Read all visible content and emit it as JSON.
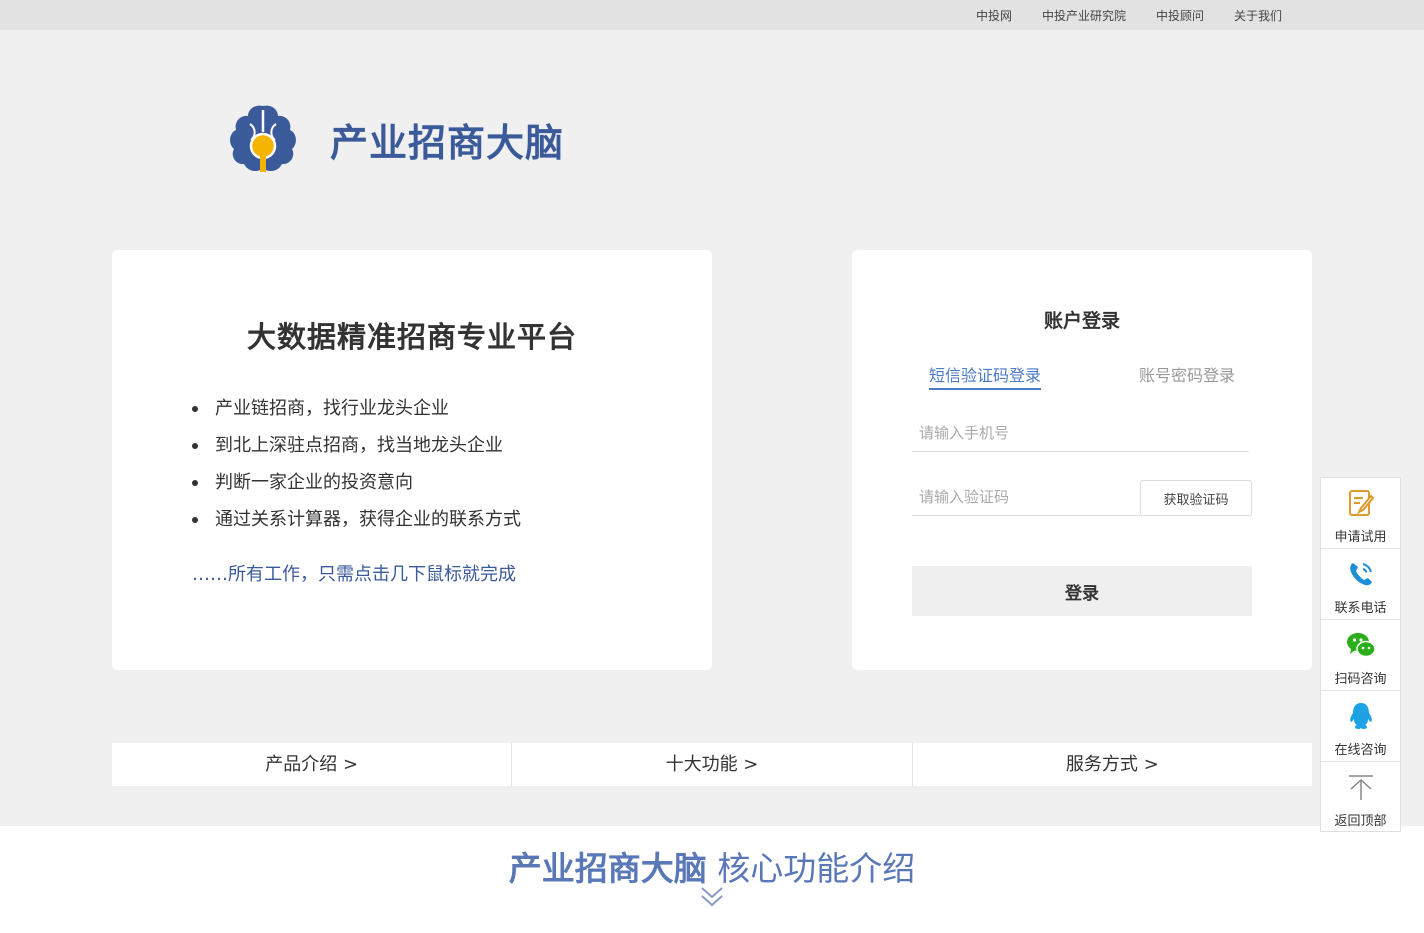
{
  "topnav": {
    "links": [
      "中投网",
      "中投产业研究院",
      "中投顾问",
      "关于我们"
    ]
  },
  "logo": {
    "text": "产业招商大脑",
    "icon": "brain-logo-icon"
  },
  "intro": {
    "title": "大数据精准招商专业平台",
    "bullets": [
      "产业链招商，找行业龙头企业",
      "到北上深驻点招商，找当地龙头企业",
      "判断一家企业的投资意向",
      "通过关系计算器，获得企业的联系方式"
    ],
    "tagline": "……所有工作，只需点击几下鼠标就完成"
  },
  "login": {
    "title": "账户登录",
    "tabs": [
      "短信验证码登录",
      "账号密码登录"
    ],
    "active_tab": "短信验证码登录",
    "phone_placeholder": "请输入手机号",
    "code_placeholder": "请输入验证码",
    "get_code_label": "获取验证码",
    "submit_label": "登录"
  },
  "nav": {
    "items": [
      "产品介绍 >",
      "十大功能 >",
      "服务方式 >"
    ]
  },
  "section": {
    "title_strong": "产业招商大脑",
    "title_rest": " 核心功能介绍"
  },
  "sidebar": {
    "items": [
      {
        "label": "申请试用",
        "icon": "edit-icon"
      },
      {
        "label": "联系电话",
        "icon": "phone-icon"
      },
      {
        "label": "扫码咨询",
        "icon": "wechat-icon"
      },
      {
        "label": "在线咨询",
        "icon": "qq-icon"
      },
      {
        "label": "返回顶部",
        "icon": "back-to-top-icon"
      }
    ]
  },
  "colors": {
    "brand_blue": "#3b5a9a",
    "tab_active": "#4a7ac8",
    "logo_yellow": "#f5b400",
    "wechat_green": "#2aae1a",
    "qq_blue": "#1ea2e6",
    "edit_orange": "#e09a2c"
  }
}
